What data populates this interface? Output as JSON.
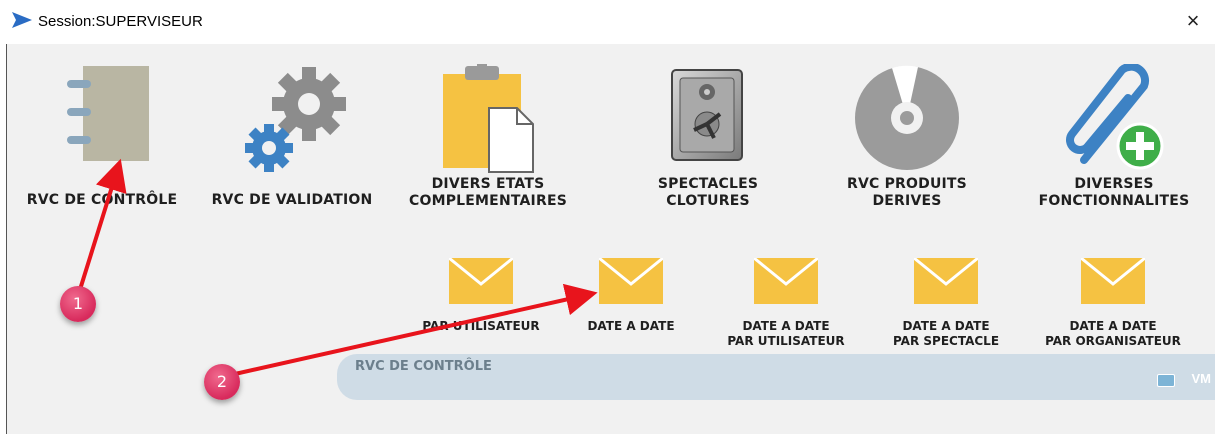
{
  "window": {
    "title": "Session:SUPERVISEUR",
    "close_glyph": "×"
  },
  "modules": [
    {
      "label": "RVC DE CONTRÔLE",
      "icon": "notebook-icon"
    },
    {
      "label": "RVC DE VALIDATION",
      "icon": "gears-icon"
    },
    {
      "label": "DIVERS ETATS\nCOMPLEMENTAIRES",
      "icon": "clipboard-document-icon"
    },
    {
      "label": "SPECTACLES\nCLOTURES",
      "icon": "safe-icon"
    },
    {
      "label": "RVC PRODUITS\nDERIVES",
      "icon": "disc-icon"
    },
    {
      "label": "DIVERSES\nFONCTIONNALITES",
      "icon": "paperclip-add-icon"
    }
  ],
  "reports": [
    {
      "label": "PAR UTILISATEUR",
      "icon": "envelope-icon"
    },
    {
      "label": "DATE A DATE",
      "icon": "envelope-icon"
    },
    {
      "label": "DATE A DATE\nPAR UTILISATEUR",
      "icon": "envelope-icon"
    },
    {
      "label": "DATE A DATE\nPAR SPECTACLE",
      "icon": "envelope-icon"
    },
    {
      "label": "DATE A DATE\nPAR ORGANISATEUR",
      "icon": "envelope-icon"
    }
  ],
  "banner": {
    "title": "RVC DE CONTRÔLE",
    "tag": "VM"
  },
  "annotations": [
    {
      "number": "1"
    },
    {
      "number": "2"
    }
  ],
  "colors": {
    "accent_yellow": "#f5c242",
    "gear_blue": "#3d82c4",
    "badge_pink": "#d82a5c",
    "arrow_red": "#e8141c",
    "banner_bg": "#cfdce6"
  }
}
